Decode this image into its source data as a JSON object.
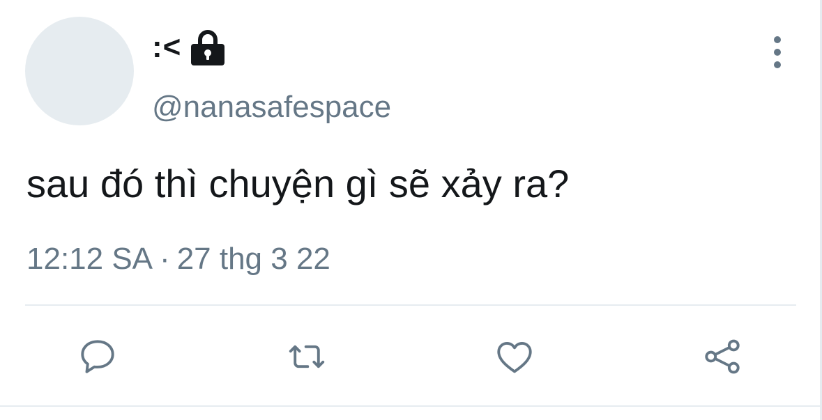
{
  "tweet": {
    "display_name": ":<",
    "handle": "@nanasafespace",
    "protected": true,
    "text": "sau đó thì chuyện gì sẽ xảy ra?",
    "time": "12:12 SA",
    "separator": "·",
    "date": "27 thg 3 22"
  },
  "icons": {
    "lock": "lock-icon",
    "more": "more-vertical-icon",
    "reply": "reply-icon",
    "retweet": "retweet-icon",
    "like": "heart-icon",
    "share": "share-icon"
  },
  "colors": {
    "text_primary": "#14171a",
    "text_secondary": "#657786",
    "avatar_placeholder": "#e6ecf0",
    "divider": "#e6ecf0"
  }
}
